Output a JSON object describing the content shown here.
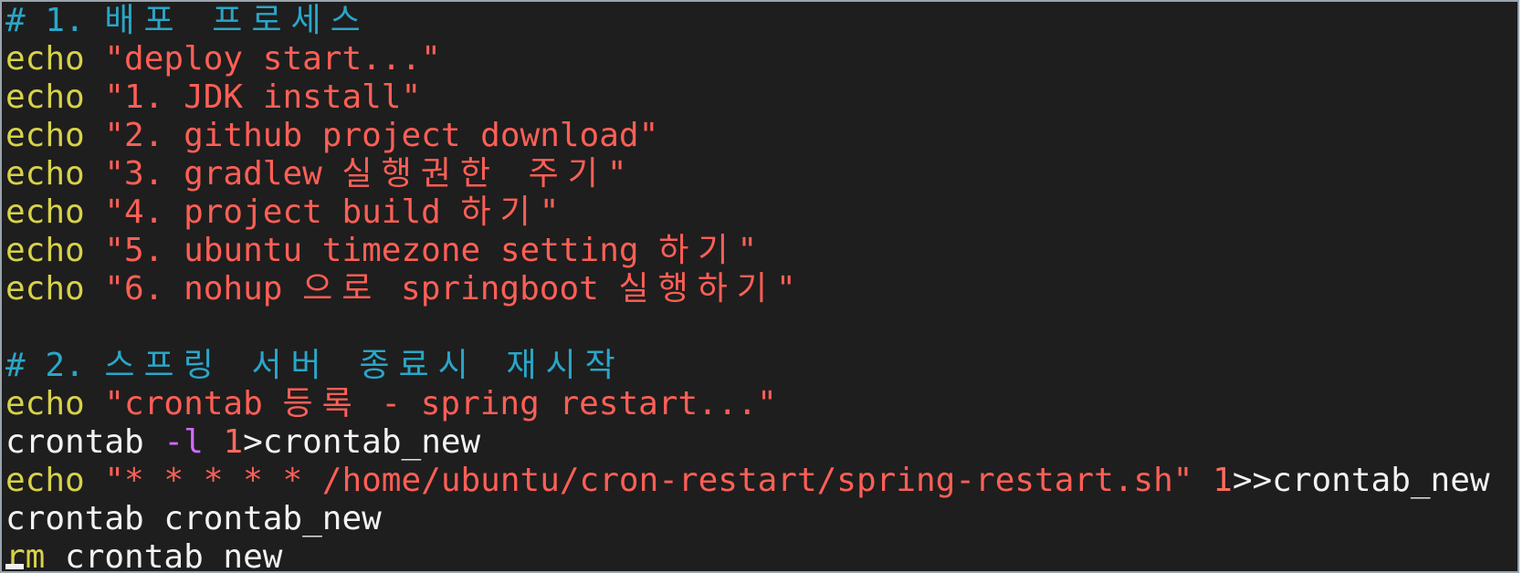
{
  "terminal": {
    "lines": [
      {
        "parts": [
          {
            "t": "# 1. ",
            "c": "comment"
          },
          {
            "t": "배포 프로세스",
            "c": "comment korean"
          }
        ]
      },
      {
        "parts": [
          {
            "t": "echo ",
            "c": "keyword"
          },
          {
            "t": "\"deploy start...\"",
            "c": "string"
          }
        ]
      },
      {
        "parts": [
          {
            "t": "echo ",
            "c": "keyword"
          },
          {
            "t": "\"1. JDK install\"",
            "c": "string"
          }
        ]
      },
      {
        "parts": [
          {
            "t": "echo ",
            "c": "keyword"
          },
          {
            "t": "\"2. github project download\"",
            "c": "string"
          }
        ]
      },
      {
        "parts": [
          {
            "t": "echo ",
            "c": "keyword"
          },
          {
            "t": "\"3. gradlew ",
            "c": "string"
          },
          {
            "t": "실행권한 주기",
            "c": "string korean"
          },
          {
            "t": "\"",
            "c": "string"
          }
        ]
      },
      {
        "parts": [
          {
            "t": "echo ",
            "c": "keyword"
          },
          {
            "t": "\"4. project build ",
            "c": "string"
          },
          {
            "t": "하기",
            "c": "string korean"
          },
          {
            "t": "\"",
            "c": "string"
          }
        ]
      },
      {
        "parts": [
          {
            "t": "echo ",
            "c": "keyword"
          },
          {
            "t": "\"5. ubuntu timezone setting ",
            "c": "string"
          },
          {
            "t": "하기",
            "c": "string korean"
          },
          {
            "t": "\"",
            "c": "string"
          }
        ]
      },
      {
        "parts": [
          {
            "t": "echo ",
            "c": "keyword"
          },
          {
            "t": "\"6. nohup ",
            "c": "string"
          },
          {
            "t": "으로",
            "c": "string korean"
          },
          {
            "t": " springboot ",
            "c": "string"
          },
          {
            "t": "실행하기",
            "c": "string korean"
          },
          {
            "t": "\"",
            "c": "string"
          }
        ]
      },
      {
        "parts": []
      },
      {
        "parts": [
          {
            "t": "# 2. ",
            "c": "comment"
          },
          {
            "t": "스프링 서버 종료시 재시작",
            "c": "comment korean"
          }
        ]
      },
      {
        "parts": [
          {
            "t": "echo ",
            "c": "keyword"
          },
          {
            "t": "\"crontab ",
            "c": "string"
          },
          {
            "t": "등록",
            "c": "string korean"
          },
          {
            "t": " - spring restart...\"",
            "c": "string"
          }
        ]
      },
      {
        "parts": [
          {
            "t": "crontab ",
            "c": "plain"
          },
          {
            "t": "-l",
            "c": "flag"
          },
          {
            "t": " ",
            "c": "plain"
          },
          {
            "t": "1",
            "c": "num"
          },
          {
            "t": ">crontab_new",
            "c": "plain"
          }
        ]
      },
      {
        "parts": [
          {
            "t": "echo ",
            "c": "keyword"
          },
          {
            "t": "\"* * * * * /home/ubuntu/cron-restart/spring-restart.sh\"",
            "c": "string"
          },
          {
            "t": " ",
            "c": "plain"
          },
          {
            "t": "1",
            "c": "num"
          },
          {
            "t": ">>crontab_new",
            "c": "plain"
          }
        ]
      },
      {
        "parts": [
          {
            "t": "crontab crontab_new",
            "c": "plain"
          }
        ]
      },
      {
        "parts": [
          {
            "t": "rm",
            "c": "keyword"
          },
          {
            "t": " crontab_new",
            "c": "plain"
          }
        ]
      }
    ]
  },
  "colors": {
    "background": "#1e1e1e",
    "comment": "#2aa6c8",
    "keyword": "#d7d24a",
    "string": "#ff5f56",
    "flag": "#d36bff",
    "number": "#ff6b5d",
    "plain": "#f2f2f2"
  }
}
